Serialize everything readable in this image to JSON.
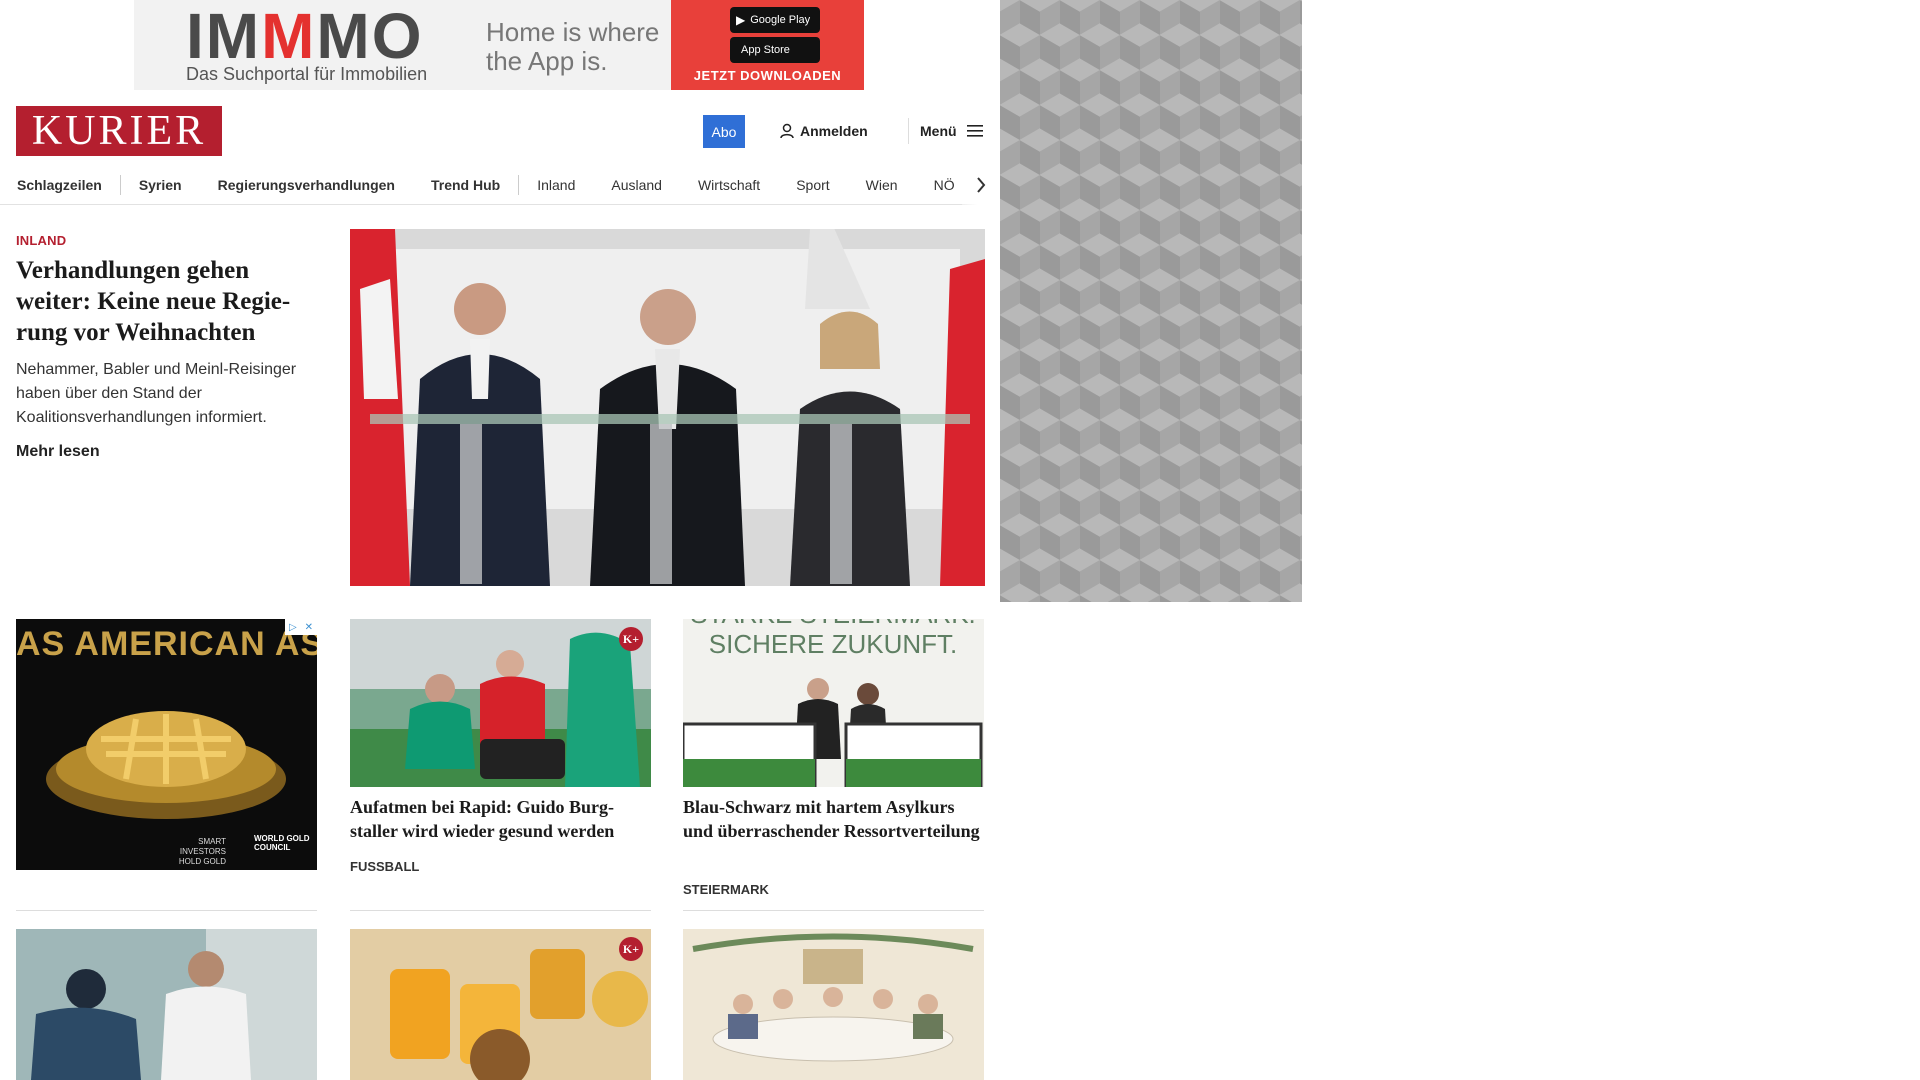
{
  "top_ad": {
    "brand_prefix": "IM",
    "brand_mm": "M",
    "brand_suffix": "MO",
    "tagline": "Das Suchportal für Immobilien",
    "slogan": "Home is where the App is.",
    "google_play": "Google Play",
    "app_store": "App Store",
    "cta": "JETZT DOWNLOADEN",
    "accent_color": "#e8403a"
  },
  "header": {
    "logo_text": "KURIER",
    "abo_label": "Abo",
    "login_label": "Anmelden",
    "menu_label": "Menü",
    "brand_color": "#b41f2f",
    "abo_color": "#2f6fd6"
  },
  "nav": {
    "items": [
      {
        "label": "Schlagzeilen",
        "bold": true
      },
      {
        "label": "Syrien",
        "bold": true
      },
      {
        "label": "Regierungsverhandlungen",
        "bold": true
      },
      {
        "label": "Trend Hub",
        "bold": true
      },
      {
        "label": "Inland",
        "bold": false
      },
      {
        "label": "Ausland",
        "bold": false
      },
      {
        "label": "Wirtschaft",
        "bold": false
      },
      {
        "label": "Sport",
        "bold": false
      },
      {
        "label": "Wien",
        "bold": false
      },
      {
        "label": "NÖ",
        "bold": false
      }
    ]
  },
  "lead": {
    "category": "INLAND",
    "title": "Verhandlungen gehen weiter: Keine neue Regie­rung vor Weihnachten",
    "teaser": "Nehammer, Babler und Meinl-Reisinger haben über den Stand der Koalitionsverhandlungen informiert.",
    "more_label": "Mehr lesen"
  },
  "ad_tile": {
    "headline": "AS AMERICAN AS",
    "sub": "SMART INVESTORS HOLD GOLD",
    "wgc": "WORLD GOLD COUNCIL"
  },
  "cards_row2": [
    {
      "title": "Aufatmen bei Rapid: Guido Burg­staller wird wieder gesund werden",
      "category": "FUSSBALL",
      "premium": true
    },
    {
      "title": "Blau-Schwarz mit hartem Asyl­kurs und überraschender Ressortverteilung",
      "category": "STEIERMARK",
      "premium": false,
      "image_text_1": "STARKE STEIERMARK.",
      "image_text_2": "SICHERE ZUKUNFT."
    }
  ]
}
